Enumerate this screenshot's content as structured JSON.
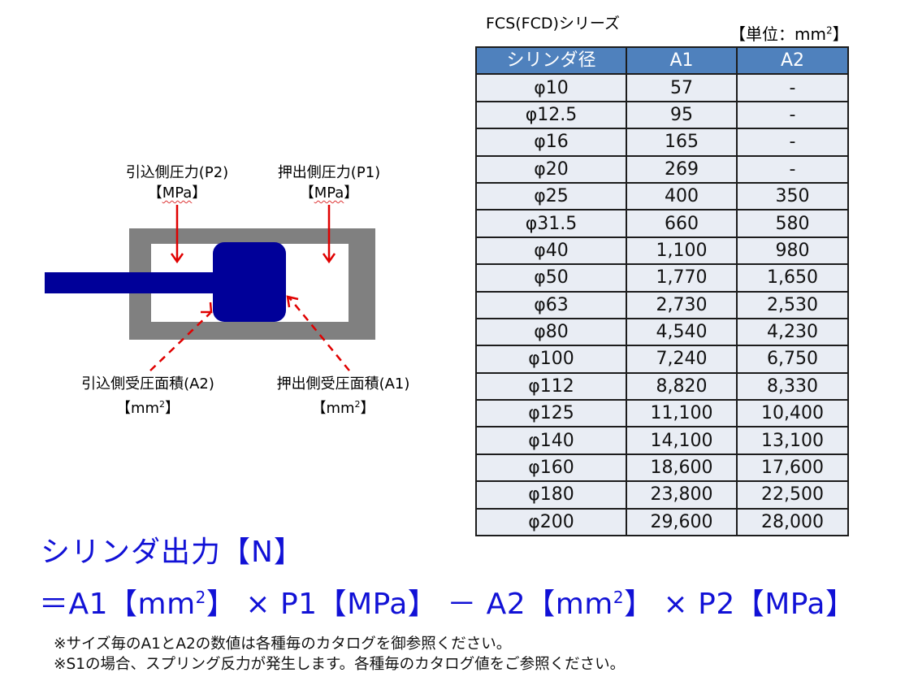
{
  "table": {
    "series_title": "FCS(FCD)シリーズ",
    "unit_label": {
      "prefix": "【単位：mm",
      "sup": "2",
      "suffix": "】"
    },
    "header_color": "#4f81bd",
    "row_color": "#e9edf4",
    "columns": [
      "シリンダ径",
      "A1",
      "A2"
    ],
    "rows": [
      [
        "φ10",
        "57",
        "-"
      ],
      [
        "φ12.5",
        "95",
        "-"
      ],
      [
        "φ16",
        "165",
        "-"
      ],
      [
        "φ20",
        "269",
        "-"
      ],
      [
        "φ25",
        "400",
        "350"
      ],
      [
        "φ31.5",
        "660",
        "580"
      ],
      [
        "φ40",
        "1,100",
        "980"
      ],
      [
        "φ50",
        "1,770",
        "1,650"
      ],
      [
        "φ63",
        "2,730",
        "2,530"
      ],
      [
        "φ80",
        "4,540",
        "4,230"
      ],
      [
        "φ100",
        "7,240",
        "6,750"
      ],
      [
        "φ112",
        "8,820",
        "8,330"
      ],
      [
        "φ125",
        "11,100",
        "10,400"
      ],
      [
        "φ140",
        "14,100",
        "13,100"
      ],
      [
        "φ160",
        "18,600",
        "17,600"
      ],
      [
        "φ180",
        "23,800",
        "22,500"
      ],
      [
        "φ200",
        "29,600",
        "28,000"
      ]
    ]
  },
  "diagram": {
    "colors": {
      "cylinder_body": "#808080",
      "piston": "#000099",
      "arrow": "#e00000"
    },
    "labels": {
      "pull_pressure": {
        "line1": "引込側圧力(P2)",
        "unit": "MPa"
      },
      "push_pressure": {
        "line1": "押出側圧力(P1)",
        "unit": "MPa"
      },
      "pull_area": {
        "line1": "引込側受圧面積(A2)",
        "unit_base": "mm",
        "unit_sup": "2"
      },
      "push_area": {
        "line1": "押出側受圧面積(A1)",
        "unit_base": "mm",
        "unit_sup": "2"
      }
    }
  },
  "formula": {
    "color": "#1111d6",
    "title": "シリンダ出力【N】",
    "parts": {
      "p1": "＝A1【mm",
      "s1": "2",
      "p2": "】 × P1【MPa】 － A2【mm",
      "s2": "2",
      "p3": "】 × P2【MPa】"
    }
  },
  "notes": [
    "※サイズ毎のA1とA2の数値は各種毎のカタログを御参照ください。",
    "※S1の場合、スプリング反力が発生します。各種毎のカタログ値をご参照ください。"
  ]
}
